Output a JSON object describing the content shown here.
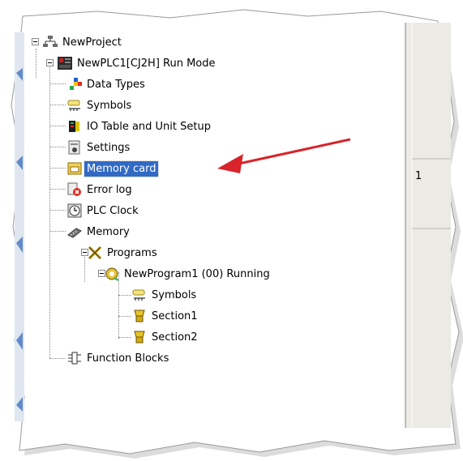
{
  "tree": {
    "root": "NewProject",
    "plc": "NewPLC1[CJ2H] Run Mode",
    "items": [
      "Data Types",
      "Symbols",
      "IO Table and Unit Setup",
      "Settings",
      "Memory card",
      "Error log",
      "PLC Clock",
      "Memory"
    ],
    "programs": "Programs",
    "program": "NewProgram1 (00) Running",
    "program_children": [
      "Symbols",
      "Section1",
      "Section2"
    ],
    "function_blocks": "Function Blocks",
    "selected": "Memory card"
  },
  "side_panel": {
    "number": "1"
  },
  "colors": {
    "selection": "#316ac5",
    "arrow": "#d9232a"
  }
}
